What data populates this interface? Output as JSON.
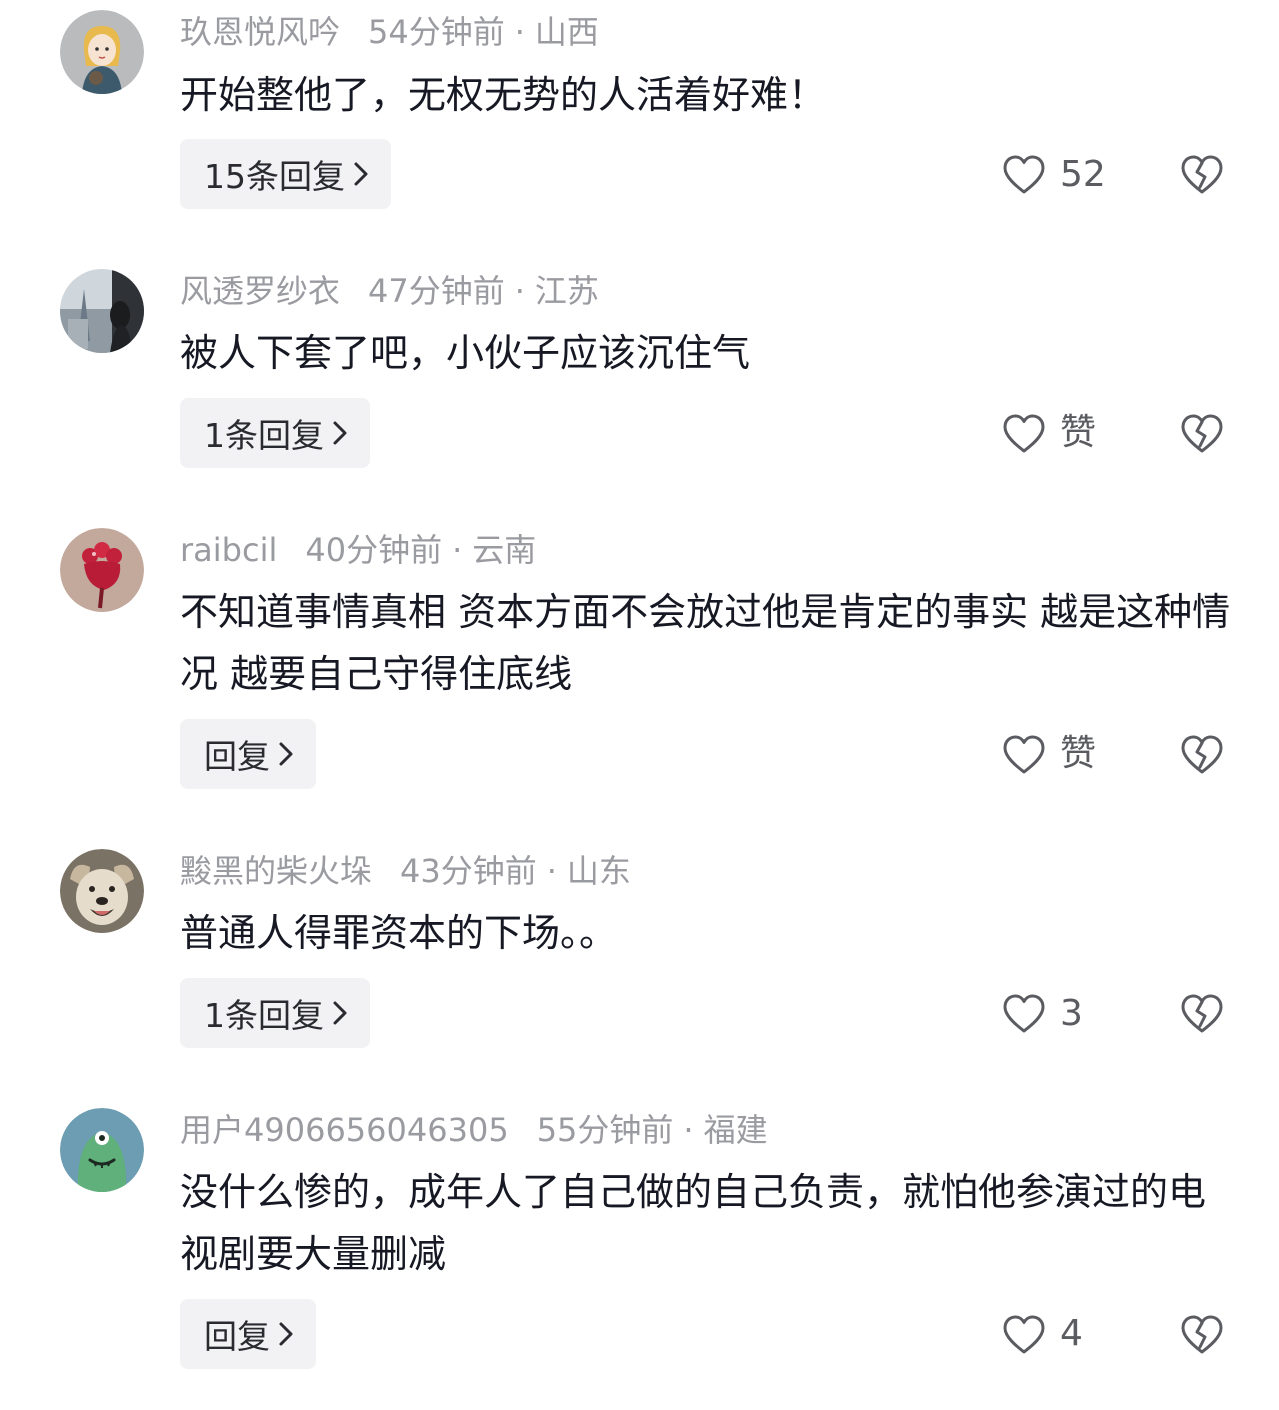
{
  "comments": [
    {
      "username": "玖恩悦风吟",
      "time": "54分钟前",
      "location": "山西",
      "text": "开始整他了，无权无势的人活着好难！",
      "reply_label": "15条回复",
      "like_label": "52",
      "avatar": "avatar-cartoon-girl"
    },
    {
      "username": "风透罗纱衣",
      "time": "47分钟前",
      "location": "江苏",
      "text": "被人下套了吧，小伙子应该沉住气",
      "reply_label": "1条回复",
      "like_label": "赞",
      "avatar": "avatar-city-photo"
    },
    {
      "username": "raibcil",
      "time": "40分钟前",
      "location": "云南",
      "text": "不知道事情真相 资本方面不会放过他是肯定的事实 越是这种情况 越要自己守得住底线",
      "reply_label": "回复",
      "like_label": "赞",
      "avatar": "avatar-red-flower"
    },
    {
      "username": "黢黑的柴火垛",
      "time": "43分钟前",
      "location": "山东",
      "text": "普通人得罪资本的下场。。",
      "reply_label": "1条回复",
      "like_label": "3",
      "avatar": "avatar-dog"
    },
    {
      "username": "用户4906656046305",
      "time": "55分钟前",
      "location": "福建",
      "text": "没什么惨的，成年人了自己做的自己负责，就怕他参演过的电视剧要大量删减",
      "reply_label": "回复",
      "like_label": "4",
      "avatar": "avatar-green-creature"
    }
  ],
  "separator": "·",
  "icons": {
    "like": "heart-outline-icon",
    "dislike": "broken-heart-icon",
    "chevron": "chevron-right-icon"
  },
  "colors": {
    "meta_text": "#9a9ba0",
    "body_text": "#161823",
    "reply_button_bg": "#f2f2f4",
    "icon_stroke": "#5b5c61"
  }
}
